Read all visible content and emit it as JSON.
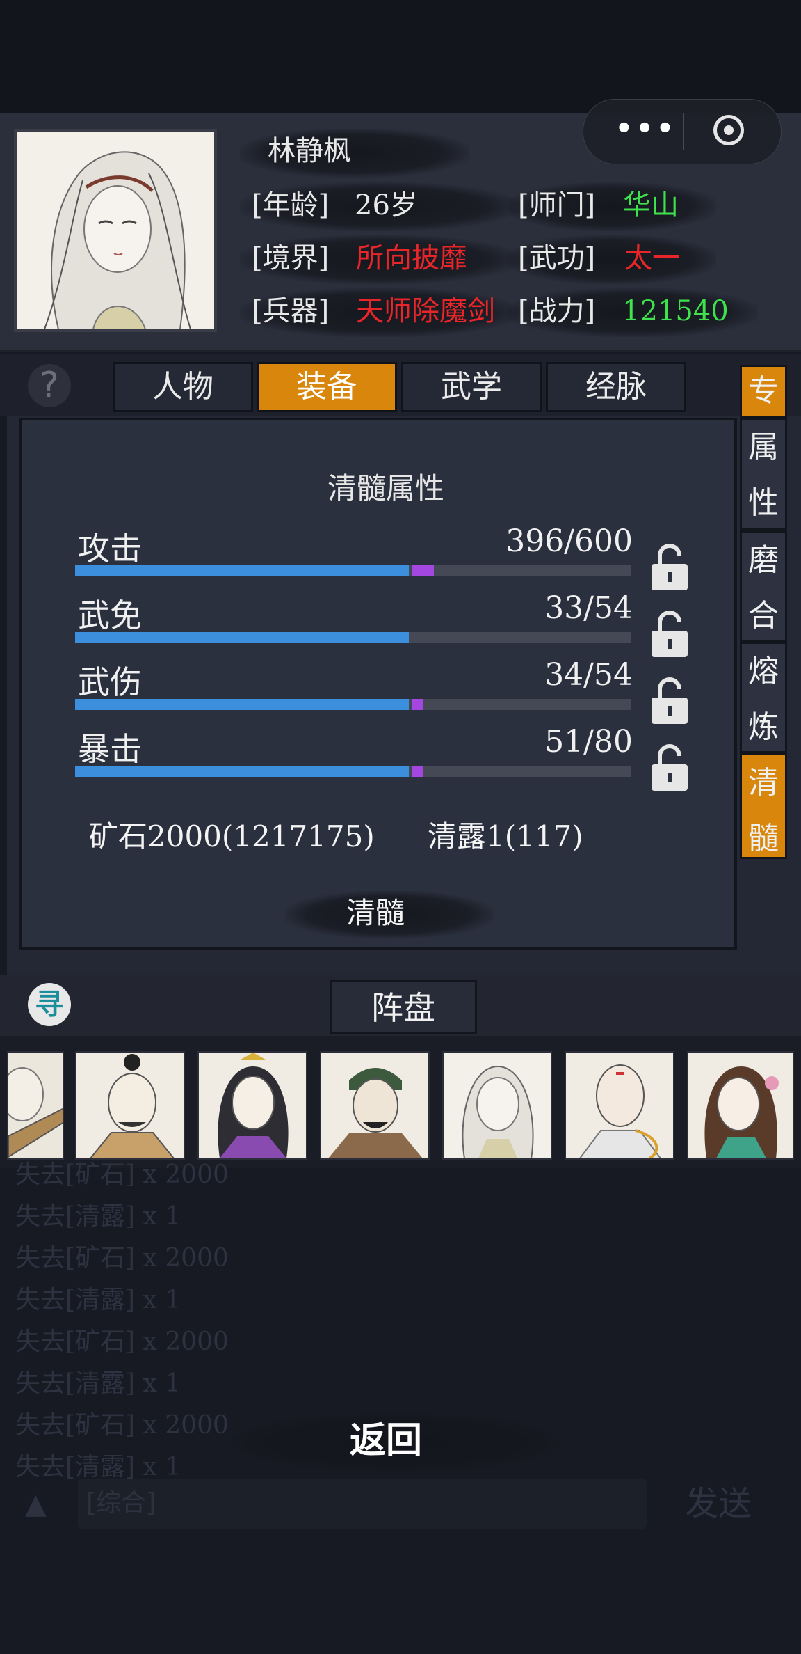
{
  "header": {
    "name": "林静枫",
    "age_label": "[年龄]",
    "age_value": "26岁",
    "sect_label": "[师门]",
    "sect_value": "华山",
    "realm_label": "[境界]",
    "realm_value": "所向披靡",
    "martial_label": "[武功]",
    "martial_value": "太一",
    "weapon_label": "[兵器]",
    "weapon_value": "天师除魔剑",
    "power_label": "[战力]",
    "power_value": "121540"
  },
  "capsule": {
    "more": "•••"
  },
  "help_label": "?",
  "tabs": [
    {
      "label": "人物",
      "active": false
    },
    {
      "label": "装备",
      "active": true
    },
    {
      "label": "武学",
      "active": false
    },
    {
      "label": "经脉",
      "active": false
    }
  ],
  "side_tabs": [
    {
      "chars": [
        "专"
      ],
      "active": true
    },
    {
      "chars": [
        "属",
        "性"
      ],
      "active": false
    },
    {
      "chars": [
        "磨",
        "合"
      ],
      "active": false
    },
    {
      "chars": [
        "熔",
        "炼"
      ],
      "active": false
    },
    {
      "chars": [
        "清",
        "髓"
      ],
      "active": true
    }
  ],
  "panel": {
    "title": "清髓属性",
    "stats": [
      {
        "name": "攻击",
        "value_text": "396/600",
        "base_fraction": 0.6,
        "extra_fraction": 0.04
      },
      {
        "name": "武免",
        "value_text": "33/54",
        "base_fraction": 0.6,
        "extra_fraction": 0.0
      },
      {
        "name": "武伤",
        "value_text": "34/54",
        "base_fraction": 0.6,
        "extra_fraction": 0.02
      },
      {
        "name": "暴击",
        "value_text": "51/80",
        "base_fraction": 0.6,
        "extra_fraction": 0.02
      }
    ],
    "cost_ore": "矿石2000(1217175)",
    "cost_dew": "清露1(117)",
    "refine_label": "清髓"
  },
  "formation": {
    "seek_icon": "寻",
    "tab_label": "阵盘"
  },
  "log": [
    "失去[矿石] x 2000",
    "失去[清露] x 1",
    "失去[矿石] x 2000",
    "失去[清露] x 1",
    "失去[矿石] x 2000",
    "失去[清露] x 1",
    "失去[矿石] x 2000",
    "失去[清露] x 1"
  ],
  "return_label": "返回",
  "chat": {
    "arrow": "▲",
    "placeholder": "[综合]",
    "send_label": "发送"
  }
}
